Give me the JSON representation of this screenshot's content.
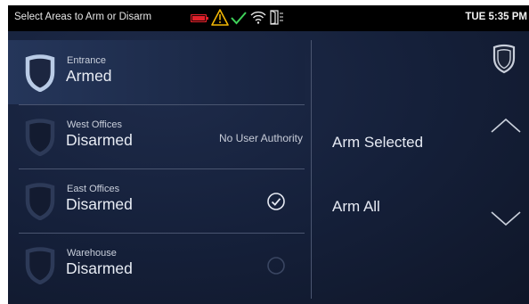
{
  "status_bar": {
    "title": "Select Areas to Arm or Disarm",
    "time": "TUE 5:35 PM",
    "icons": [
      "battery-icon",
      "warning-icon",
      "checkmark-icon",
      "wifi-icon",
      "door-icon"
    ],
    "icon_colors": {
      "battery": "#e0202a",
      "warning": "#f2b705",
      "check": "#3fd35a"
    }
  },
  "areas": [
    {
      "name": "Entrance",
      "status": "Armed",
      "note": "",
      "selected": true
    },
    {
      "name": "West Offices",
      "status": "Disarmed",
      "note": "No User Authority",
      "selected": false
    },
    {
      "name": "East Offices",
      "status": "Disarmed",
      "note": "",
      "selected": false,
      "checked": true
    },
    {
      "name": "Warehouse",
      "status": "Disarmed",
      "note": "",
      "selected": false,
      "checked": false
    }
  ],
  "actions": {
    "arm_selected": "Arm Selected",
    "arm_all": "Arm All"
  },
  "colors": {
    "background": "#12192b",
    "accent_text": "#e8ecf4",
    "divider": "#4a5570"
  }
}
